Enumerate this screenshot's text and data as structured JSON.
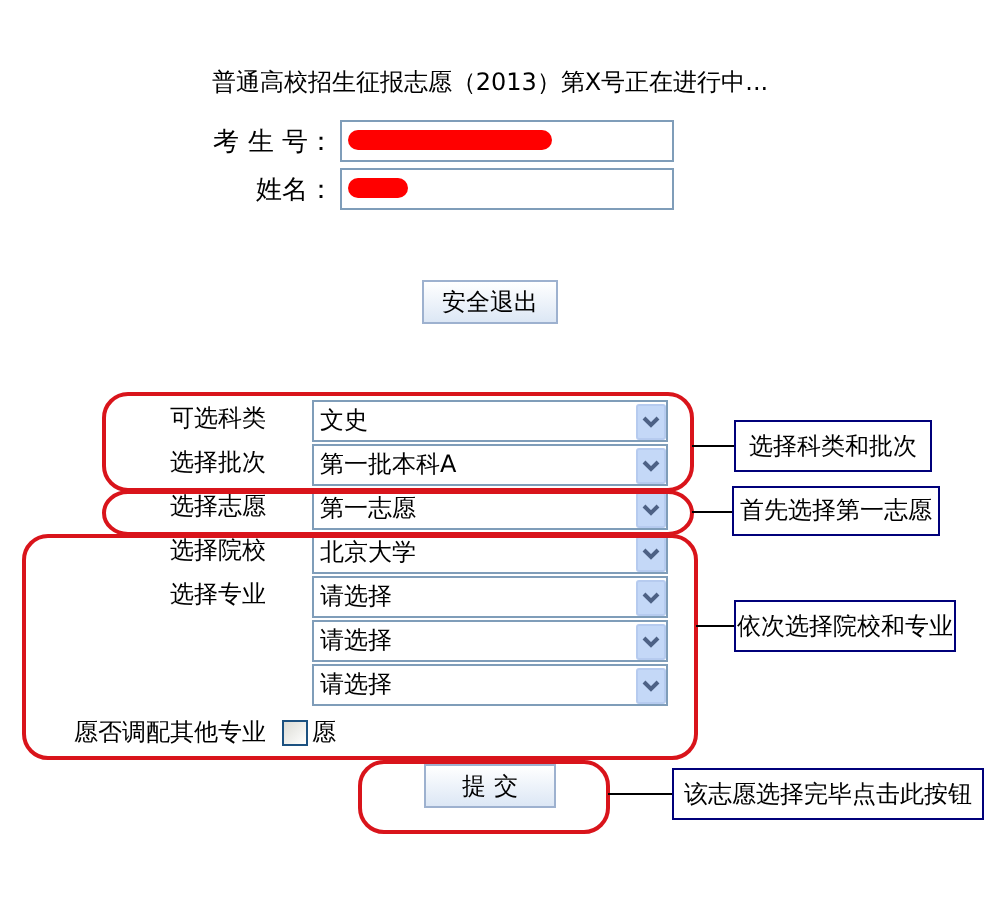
{
  "title": "普通高校招生征报志愿（2013）第X号正在进行中...",
  "candidate": [
    {
      "label": "考 生 号：",
      "redacted": true
    },
    {
      "label": "姓名：",
      "redacted": true
    }
  ],
  "logout_button": "安全退出",
  "selects": [
    {
      "label": "可选科类",
      "value": "文史"
    },
    {
      "label": "选择批次",
      "value": "第一批本科A"
    },
    {
      "label": "选择志愿",
      "value": "第一志愿"
    },
    {
      "label": "选择院校",
      "value": "北京大学"
    },
    {
      "label": "选择专业",
      "value": "请选择"
    },
    {
      "value": "请选择"
    },
    {
      "value": "请选择"
    }
  ],
  "adjust": {
    "label": "愿否调配其他专业",
    "option": "愿",
    "checked": false
  },
  "submit_button": "提 交",
  "annotations": [
    "选择科类和批次",
    "首先选择第一志愿",
    "依次选择院校和专业",
    "该志愿选择完毕点击此按钮"
  ]
}
